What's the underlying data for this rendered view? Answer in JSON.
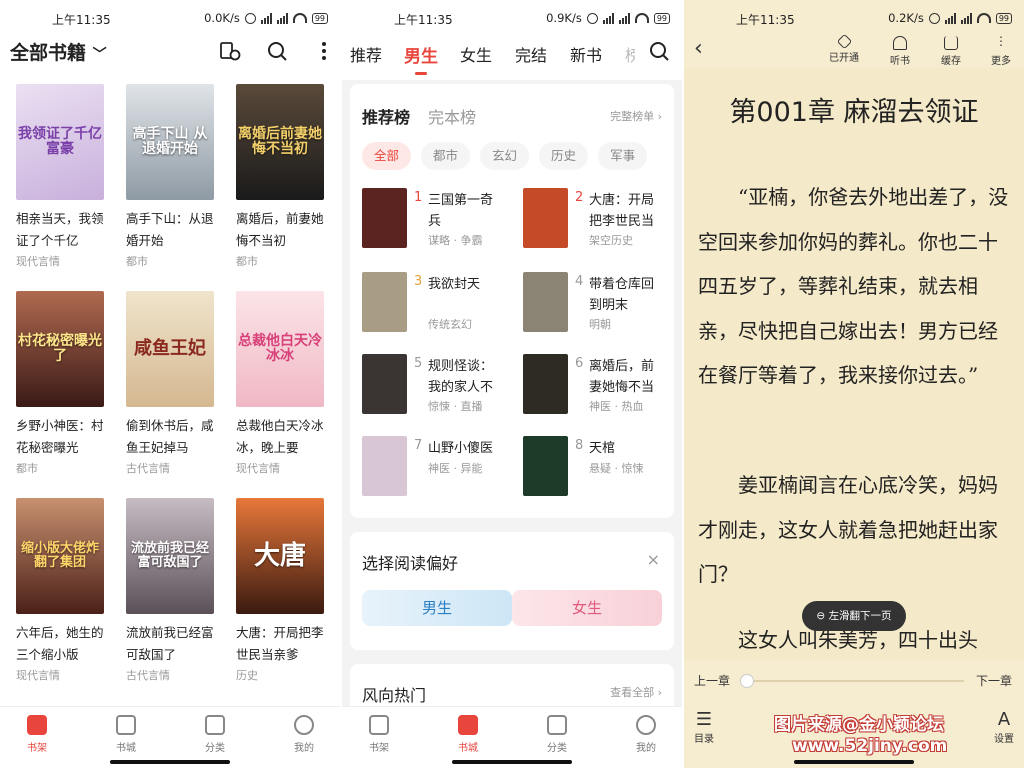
{
  "status": {
    "s1": {
      "time": "上午11:35",
      "speed": "0.0K/s",
      "battery": "99"
    },
    "s2": {
      "time": "上午11:35",
      "speed": "0.9K/s",
      "battery": "99"
    },
    "s3": {
      "time": "上午11:35",
      "speed": "0.2K/s",
      "battery": "99"
    }
  },
  "shelf": {
    "title": "全部书籍",
    "books": [
      {
        "title": "相亲当天，我领证了个千亿",
        "category": "现代言情",
        "cover_text": "我领证了千亿富豪",
        "color": "#d8c8e8"
      },
      {
        "title": "高手下山：从退婚开始",
        "category": "都市",
        "cover_text": "高手下山 从退婚开始",
        "color": "#b8c2cc"
      },
      {
        "title": "离婚后，前妻她悔不当初",
        "category": "都市",
        "cover_text": "离婚后前妻她悔不当初",
        "color": "#2a2a2a"
      },
      {
        "title": "乡野小神医：村花秘密曝光",
        "category": "都市",
        "cover_text": "村花秘密曝光了",
        "color": "#7a3a30"
      },
      {
        "title": "偷到休书后，咸鱼王妃掉马",
        "category": "古代言情",
        "cover_text": "咸鱼王妃",
        "color": "#e6d4b8"
      },
      {
        "title": "总裁他白天冷冰冰，晚上要",
        "category": "现代言情",
        "cover_text": "总裁他白天冷冰冰",
        "color": "#f1c9d0"
      },
      {
        "title": "六年后，她生的三个缩小版",
        "category": "现代言情",
        "cover_text": "缩小版大佬炸翻了集团",
        "color": "#6b3a2e"
      },
      {
        "title": "流放前我已经富可敌国了",
        "category": "古代言情",
        "cover_text": "流放前我已经富可敌国了",
        "color": "#8a7f86"
      },
      {
        "title": "大唐：开局把李世民当亲爹",
        "category": "历史",
        "cover_text": "大唐",
        "color": "#c8542e"
      }
    ],
    "tabs": [
      "书架",
      "书城",
      "分类",
      "我的"
    ]
  },
  "store": {
    "nav": [
      "推荐",
      "男生",
      "女生",
      "完结",
      "新书",
      "榜"
    ],
    "active_nav": "男生",
    "rank_tab": "推荐榜",
    "rank_tab2": "完本榜",
    "rank_more": "完整榜单 ›",
    "chips": [
      "全部",
      "都市",
      "玄幻",
      "历史",
      "军事"
    ],
    "ranks": [
      {
        "no": "1",
        "title": "三国第一奇兵",
        "sub": "谋略 · 争霸",
        "color": "#5b2420"
      },
      {
        "no": "2",
        "title": "大唐：开局把李世民当",
        "sub": "架空历史",
        "color": "#c44a28"
      },
      {
        "no": "3",
        "title": "我欲封天",
        "sub": "传统玄幻",
        "color": "#a99c84"
      },
      {
        "no": "4",
        "title": "带着仓库回到明末",
        "sub": "明朝",
        "color": "#8b8474"
      },
      {
        "no": "5",
        "title": "规则怪谈：我的家人不",
        "sub": "惊悚 · 直播",
        "color": "#3a3432"
      },
      {
        "no": "6",
        "title": "离婚后，前妻她悔不当",
        "sub": "神医 · 热血",
        "color": "#2e2a24"
      },
      {
        "no": "7",
        "title": "山野小傻医",
        "sub": "神医 · 异能",
        "color": "#d9c6d4"
      },
      {
        "no": "8",
        "title": "天棺",
        "sub": "悬疑 · 惊悚",
        "color": "#1e3a28"
      }
    ],
    "pref_title": "选择阅读偏好",
    "pref_male": "男生",
    "pref_female": "女生",
    "hot_title": "风向热门",
    "hot_more": "查看全部 ›",
    "tabs": [
      "书架",
      "书城",
      "分类",
      "我的"
    ]
  },
  "reader": {
    "actions": [
      "已开通",
      "听书",
      "缓存",
      "更多"
    ],
    "chapter": "第001章 麻溜去领证",
    "paragraph1": "“亚楠，你爸去外地出差了，没空回来参加你妈的葬礼。你也二十四五岁了，等葬礼结束，就去相亲，尽快把自己嫁出去！男方已经在餐厅等着了，我来接你过去。”",
    "paragraph2": "姜亚楠闻言在心底冷笑，妈妈才刚走，这女人就着急把她赶出家门？",
    "paragraph3": "这女人叫朱美芳，四十出头",
    "toast": "左滑翻下一页",
    "prev": "上一章",
    "next": "下一章",
    "menu": "目录",
    "settings": "设置",
    "watermark1": "图片来源@金小颖论坛",
    "watermark2": "www.52jiny.com"
  }
}
